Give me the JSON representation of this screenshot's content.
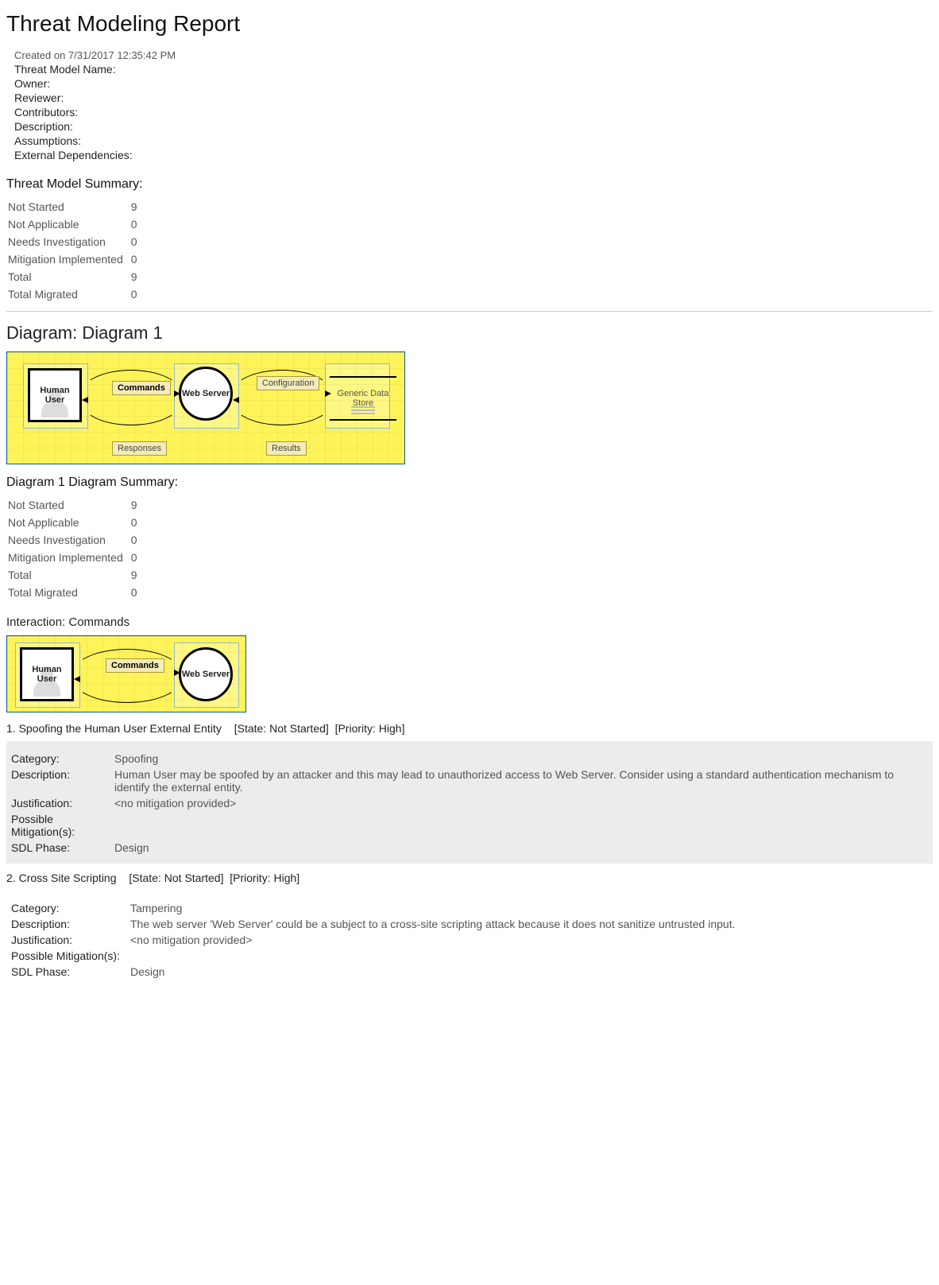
{
  "title": "Threat Modeling Report",
  "created": "Created on 7/31/2017 12:35:42 PM",
  "meta": {
    "model_name_label": "Threat Model Name:",
    "owner_label": "Owner:",
    "reviewer_label": "Reviewer:",
    "contributors_label": "Contributors:",
    "description_label": "Description:",
    "assumptions_label": "Assumptions:",
    "ext_deps_label": "External Dependencies:"
  },
  "summary_head": "Threat Model Summary:",
  "summary": [
    {
      "label": "Not Started",
      "value": "9"
    },
    {
      "label": "Not Applicable",
      "value": "0"
    },
    {
      "label": "Needs Investigation",
      "value": "0"
    },
    {
      "label": "Mitigation Implemented",
      "value": "0"
    },
    {
      "label": "Total",
      "value": "9"
    },
    {
      "label": "Total Migrated",
      "value": "0"
    }
  ],
  "diagram_head": "Diagram: Diagram 1",
  "diagram1": {
    "human_user": "Human User",
    "web_server": "Web Server",
    "generic_store": "Generic Data Store",
    "commands": "Commands",
    "responses": "Responses",
    "configuration": "Configuration",
    "results": "Results"
  },
  "diagram_summary_head": "Diagram 1 Diagram Summary:",
  "diagram_summary": [
    {
      "label": "Not Started",
      "value": "9"
    },
    {
      "label": "Not Applicable",
      "value": "0"
    },
    {
      "label": "Needs Investigation",
      "value": "0"
    },
    {
      "label": "Mitigation Implemented",
      "value": "0"
    },
    {
      "label": "Total",
      "value": "9"
    },
    {
      "label": "Total Migrated",
      "value": "0"
    }
  ],
  "interaction_head": "Interaction: Commands",
  "threats": [
    {
      "num": "1.",
      "title": "Spoofing the Human User External Entity",
      "state": "[State: Not Started]",
      "priority": "[Priority: High]",
      "category": "Spoofing",
      "description": "Human User may be spoofed by an attacker and this may lead to unauthorized access to Web Server. Consider using a standard authentication mechanism to identify the external entity.",
      "justification": "<no mitigation provided>",
      "mitigations": "",
      "sdl": "Design"
    },
    {
      "num": "2.",
      "title": "Cross Site Scripting",
      "state": "[State: Not Started]",
      "priority": "[Priority: High]",
      "category": "Tampering",
      "description": "The web server 'Web Server' could be a subject to a cross-site scripting attack because it does not sanitize untrusted input.",
      "justification": "<no mitigation provided>",
      "mitigations": "",
      "sdl": "Design"
    }
  ],
  "labels": {
    "category": "Category:",
    "description": "Description:",
    "justification": "Justification:",
    "mitigations": "Possible Mitigation(s):",
    "sdl": "SDL Phase:"
  }
}
